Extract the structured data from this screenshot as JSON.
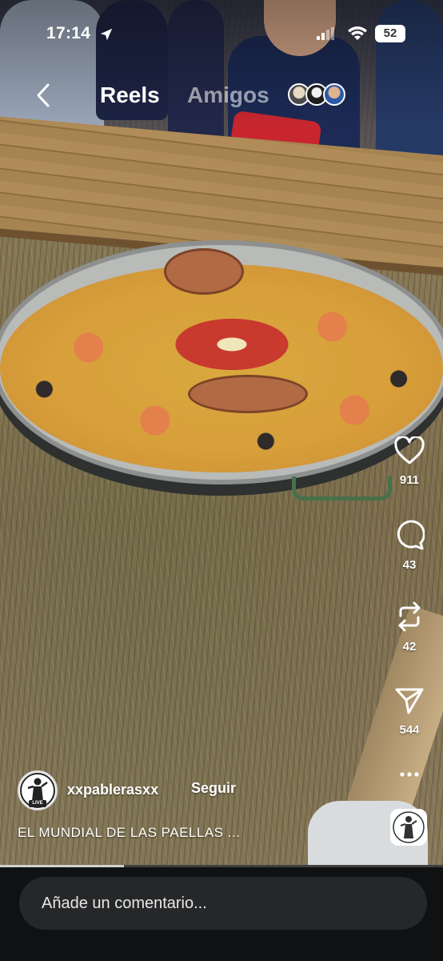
{
  "status_bar": {
    "time": "17:14",
    "battery": "52"
  },
  "header": {
    "tab_reels": "Reels",
    "tab_amigos": "Amigos"
  },
  "actions": {
    "likes": "911",
    "comments": "43",
    "reposts": "42",
    "shares": "544"
  },
  "post": {
    "username": "xxpablerasxx",
    "follow_label": "Seguir",
    "caption": "EL MUNDIAL DE LAS PAELLAS ...",
    "live_badge": "LIVE",
    "progress": 0.28
  },
  "comment": {
    "placeholder": "Añade un comentario..."
  },
  "colors": {
    "bottom_bar": "#101112",
    "comment_box": "#262729",
    "text": "#ffffff"
  }
}
